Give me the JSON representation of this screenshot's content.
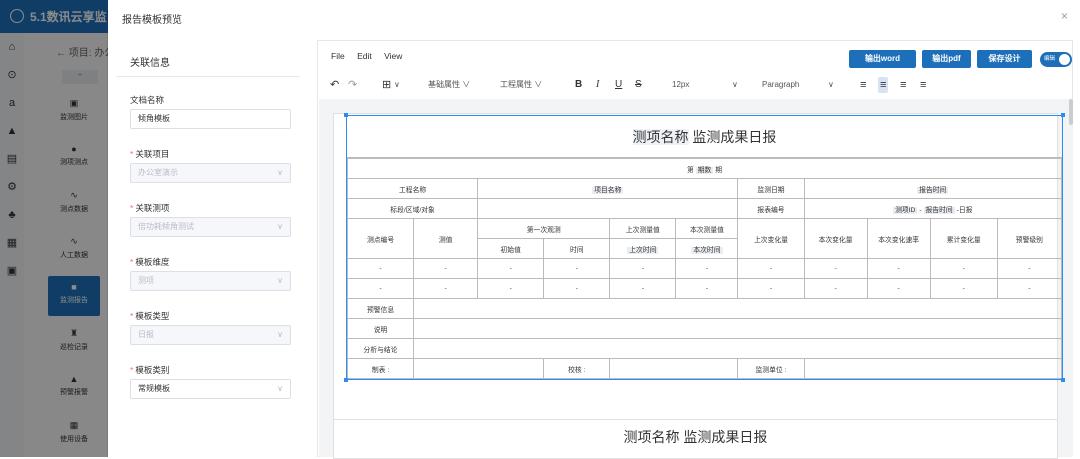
{
  "bg": {
    "app_title": "5.1数讯云享监",
    "breadcrumb": "← 项目: 办公",
    "nav": [
      {
        "icon": "▣",
        "label": "监测图片"
      },
      {
        "icon": "●",
        "label": "测项测点"
      },
      {
        "icon": "∿",
        "label": "测点数据"
      },
      {
        "icon": "∿",
        "label": "人工数据"
      },
      {
        "icon": "■",
        "label": "监测报告"
      },
      {
        "icon": "♜",
        "label": "巡检记录"
      },
      {
        "icon": "▲",
        "label": "预警报警"
      },
      {
        "icon": "▦",
        "label": "使用设备"
      }
    ],
    "rail_icons": [
      "⌂",
      "⊙",
      "a",
      "▲",
      "▤",
      "⚙",
      "♣",
      "▦",
      "▣"
    ]
  },
  "dialog": {
    "title": "报告模板预览",
    "close": "×"
  },
  "form": {
    "heading": "关联信息",
    "fields": [
      {
        "label": "文档名称",
        "required": false,
        "value": "倾角模板",
        "disabled": false,
        "select": false
      },
      {
        "label": "关联项目",
        "required": true,
        "value": "办公室演示",
        "disabled": true,
        "select": true
      },
      {
        "label": "关联测项",
        "required": true,
        "value": "倍功耗倾角测试",
        "disabled": true,
        "select": true
      },
      {
        "label": "模板维度",
        "required": true,
        "value": "测项",
        "disabled": true,
        "select": true
      },
      {
        "label": "模板类型",
        "required": true,
        "value": "日报",
        "disabled": true,
        "select": true
      },
      {
        "label": "模板类别",
        "required": true,
        "value": "常规模板",
        "disabled": false,
        "select": true
      }
    ]
  },
  "editor": {
    "menu": [
      "File",
      "Edit",
      "View"
    ],
    "buttons": {
      "export_word": "输出word",
      "export_pdf": "输出pdf",
      "save": "保存设计"
    },
    "toggle_label": "编辑",
    "toolbar": {
      "undo": "↶",
      "redo": "↷",
      "table": "⊞",
      "basic_props": "基础属性",
      "project_props": "工程属性",
      "bold": "B",
      "italic": "I",
      "underline": "U",
      "strike": "S",
      "font_size": "12px",
      "block_format": "Paragraph"
    }
  },
  "report": {
    "title_part1": "测项名称",
    "title_part2": " 监测成果日报",
    "period_pre": "第",
    "period_ph": "期数",
    "period_post": "期",
    "row_project": {
      "label": "工程名称",
      "value": "项目名称",
      "date_label": "监测日期",
      "date_value": "报告时间"
    },
    "row_section": {
      "label": "标段/区域/对象",
      "code_label": "报表编号",
      "code_value_a": "测项ID",
      "code_sep": " - ",
      "code_value_b": "报告时间",
      "code_suffix": " -日报"
    },
    "header": {
      "point_no": "测点编号",
      "item": "测值",
      "first": "第一次观测",
      "last_value": "上次测量值",
      "this_value": "本次测量值",
      "last_change": "上次变化量",
      "this_change": "本次变化量",
      "this_rate": "本次变化速率",
      "total_change": "累计变化量",
      "alarm": "预警级别",
      "initial": "初始值",
      "time": "时间",
      "last_time": "上次时间",
      "this_time": "本次时间"
    },
    "dash": "-",
    "footer": {
      "warning": "预警信息",
      "note": "说明",
      "analysis": "分析与结论",
      "made_by": "制表 :",
      "checked_by": "校核 :",
      "unit": "监测单位 :"
    },
    "page2_title_part1": "测项名称",
    "page2_title_part2": " 监测成果日报"
  }
}
